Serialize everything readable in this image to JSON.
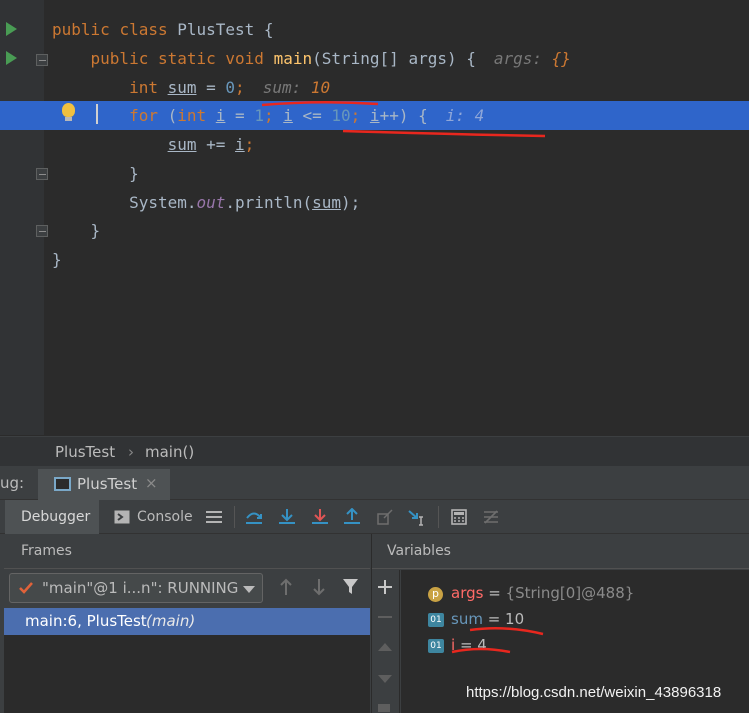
{
  "editor": {
    "lines": [
      {
        "indent": "",
        "tokens": [
          [
            "kw",
            "public "
          ],
          [
            "kw",
            "class "
          ],
          [
            "plain",
            "PlusTest {"
          ]
        ]
      },
      {
        "indent": "    ",
        "tokens": [
          [
            "kw",
            "public "
          ],
          [
            "kw",
            "static "
          ],
          [
            "kw",
            "void "
          ],
          [
            "fn",
            "main"
          ],
          [
            "plain",
            "(String[] args) {"
          ]
        ],
        "hint_name": "args: ",
        "hint_value": "{}"
      },
      {
        "indent": "        ",
        "tokens": [
          [
            "kw",
            "int "
          ],
          [
            "local",
            "sum"
          ],
          [
            "plain",
            " = "
          ],
          [
            "num",
            "0"
          ],
          [
            "kw",
            ";"
          ]
        ],
        "hint_name": "sum: ",
        "hint_value": "10"
      },
      {
        "indent": "        ",
        "tokens": [
          [
            "kw",
            "for "
          ],
          [
            "plain",
            "("
          ],
          [
            "kw",
            "int "
          ],
          [
            "local",
            "i"
          ],
          [
            "plain",
            " = "
          ],
          [
            "num",
            "1"
          ],
          [
            "kw",
            "; "
          ],
          [
            "local",
            "i"
          ],
          [
            "plain",
            " <= "
          ],
          [
            "num",
            "10"
          ],
          [
            "kw",
            "; "
          ],
          [
            "local",
            "i"
          ],
          [
            "plain",
            "++) {"
          ]
        ],
        "hint_name": "i: ",
        "hint_value": "4"
      },
      {
        "indent": "            ",
        "tokens": [
          [
            "local",
            "sum"
          ],
          [
            "plain",
            " += "
          ],
          [
            "local",
            "i"
          ],
          [
            "kw",
            ";"
          ]
        ]
      },
      {
        "indent": "        ",
        "tokens": [
          [
            "plain",
            "}"
          ]
        ]
      },
      {
        "indent": "        ",
        "tokens": [
          [
            "plain",
            "System."
          ],
          [
            "static",
            "out"
          ],
          [
            "plain",
            ".println("
          ],
          [
            "local",
            "sum"
          ],
          [
            "plain",
            ");"
          ]
        ]
      },
      {
        "indent": "    ",
        "tokens": [
          [
            "plain",
            "}"
          ]
        ]
      },
      {
        "indent": "",
        "tokens": [
          [
            "plain",
            "}"
          ]
        ]
      }
    ]
  },
  "breadcrumb": {
    "class_name": "PlusTest",
    "separator": "›",
    "method_name": "main()"
  },
  "debug": {
    "title_prefix": "ug:",
    "session_tab": "PlusTest",
    "close_glyph": "×",
    "tabs": {
      "debugger": "Debugger",
      "console": "Console"
    }
  },
  "frames": {
    "title": "Frames",
    "thread": "\"main\"@1 i...n\": RUNNING",
    "selected_frame": "main:6, PlusTest",
    "selected_frame_method": "(main)"
  },
  "variables": {
    "title": "Variables",
    "items": [
      {
        "icon": "p",
        "name": "args",
        "eq": " = ",
        "value": "{String[0]@488}",
        "name_color": "#ff6b68",
        "value_color": "#8a8a8a"
      },
      {
        "icon": "01",
        "name": "sum",
        "eq": " = ",
        "value": "10",
        "name_color": "#6897bb",
        "value_color": "#bbbbbb"
      },
      {
        "icon": "01",
        "name": "i",
        "eq": " = ",
        "value": "4",
        "name_color": "#ff6b68",
        "value_color": "#bbbbbb"
      }
    ]
  },
  "watermark": "https://blog.csdn.net/weixin_43896318",
  "colors": {
    "accent": "#2f65ca",
    "selection": "#4b6eaf",
    "annotation": "#e8271e"
  }
}
